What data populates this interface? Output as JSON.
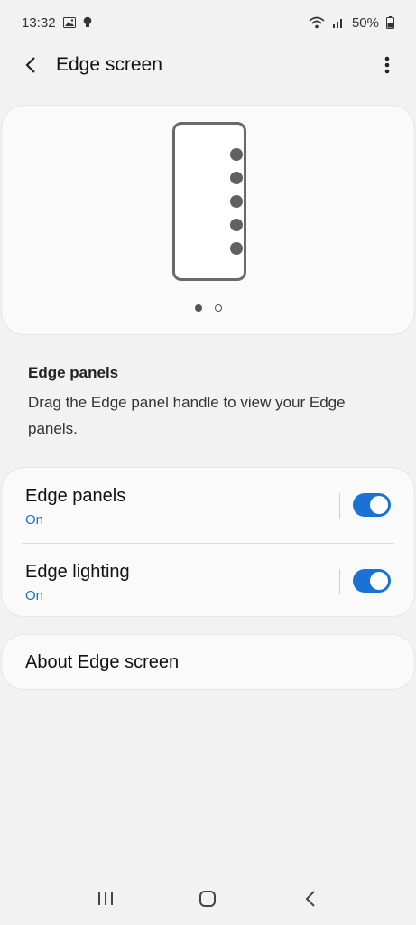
{
  "status_bar": {
    "time": "13:32",
    "left_icons": [
      "gallery-icon",
      "notification-bulb-icon"
    ],
    "right_icons": [
      "wifi-icon",
      "signal-icon",
      "battery-icon"
    ],
    "battery": "50%"
  },
  "app_bar": {
    "title": "Edge screen",
    "back_icon": "chevron-left-icon",
    "more_icon": "more-vertical-icon"
  },
  "preview": {
    "pager_pages": 2,
    "active_page": 1
  },
  "description": {
    "title": "Edge panels",
    "body": "Drag the Edge panel handle to view your Edge panels."
  },
  "settings": [
    {
      "label": "Edge panels",
      "status": "On",
      "enabled": true
    },
    {
      "label": "Edge lighting",
      "status": "On",
      "enabled": true
    }
  ],
  "about": {
    "label": "About Edge screen"
  },
  "nav_bar": {
    "buttons": [
      "recents-icon",
      "home-icon",
      "back-icon"
    ]
  },
  "colors": {
    "background": "#f2f2f2",
    "card": "#fafafa",
    "accent": "#1a73d4",
    "status_text": "#1a73c4"
  }
}
